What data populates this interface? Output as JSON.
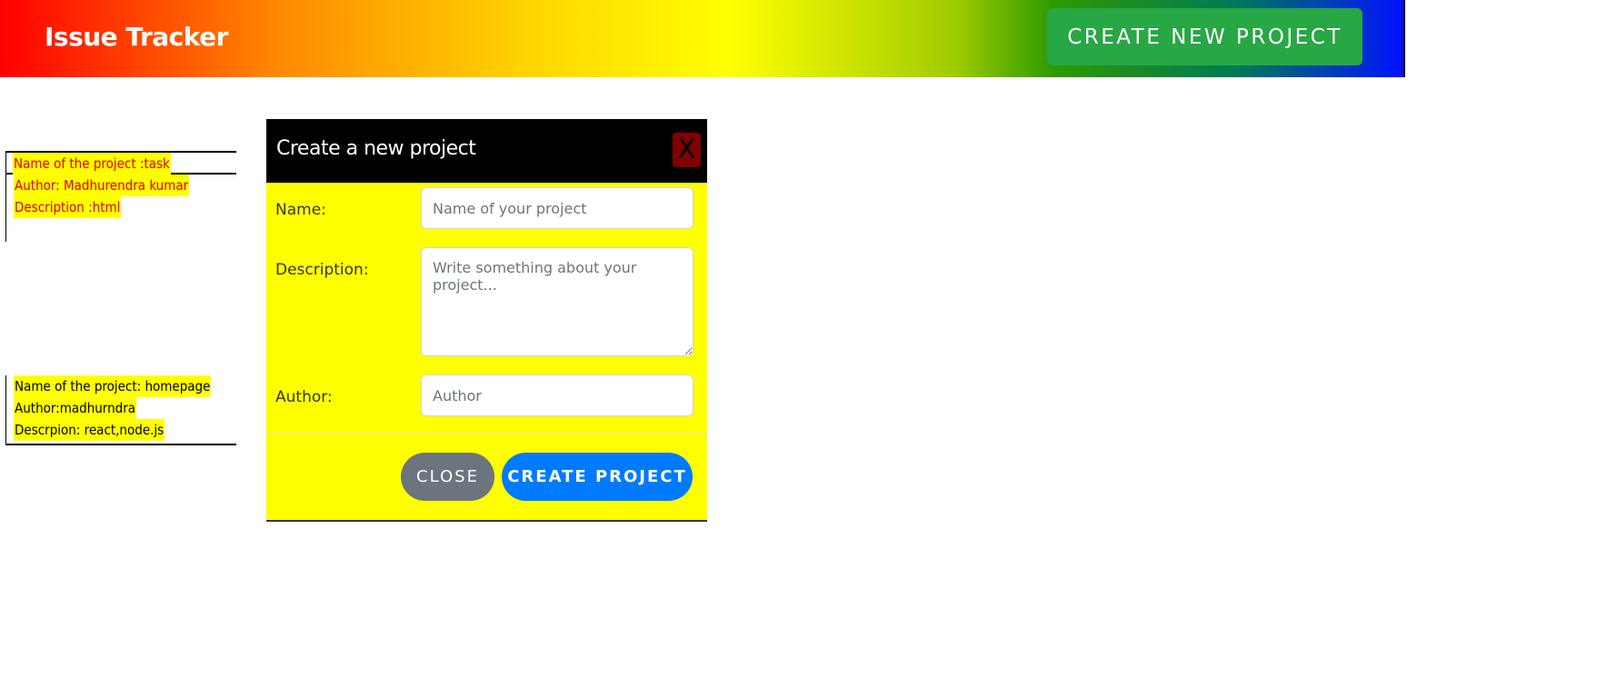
{
  "header": {
    "title": "Issue Tracker",
    "create_button_label": "CREATE NEW PROJECT"
  },
  "projects": [
    {
      "title_line": "Name of the project :task",
      "author_line": "Author: Madhurendra kumar",
      "description_line": "Description :html"
    },
    {
      "title_line": "Name of the project: homepage",
      "author_line": "Author:madhurndra",
      "description_line": "Descrpion: react,node.js"
    }
  ],
  "modal": {
    "title": "Create a new project",
    "close_icon": "X",
    "fields": {
      "name": {
        "label": "Name:",
        "placeholder": "Name of your project"
      },
      "description": {
        "label": "Description:",
        "placeholder": "Write something about your project..."
      },
      "author": {
        "label": "Author:",
        "placeholder": "Author"
      }
    },
    "close_button_label": "CLOSE",
    "create_button_label": "CREATE PROJECT"
  },
  "colors": {
    "create_new_project_button": "#28a745",
    "modal_background": "#ffff00",
    "modal_header": "#000000",
    "create_project_button": "#007bff",
    "close_button": "#6c757d",
    "highlight": "#ffff00"
  }
}
